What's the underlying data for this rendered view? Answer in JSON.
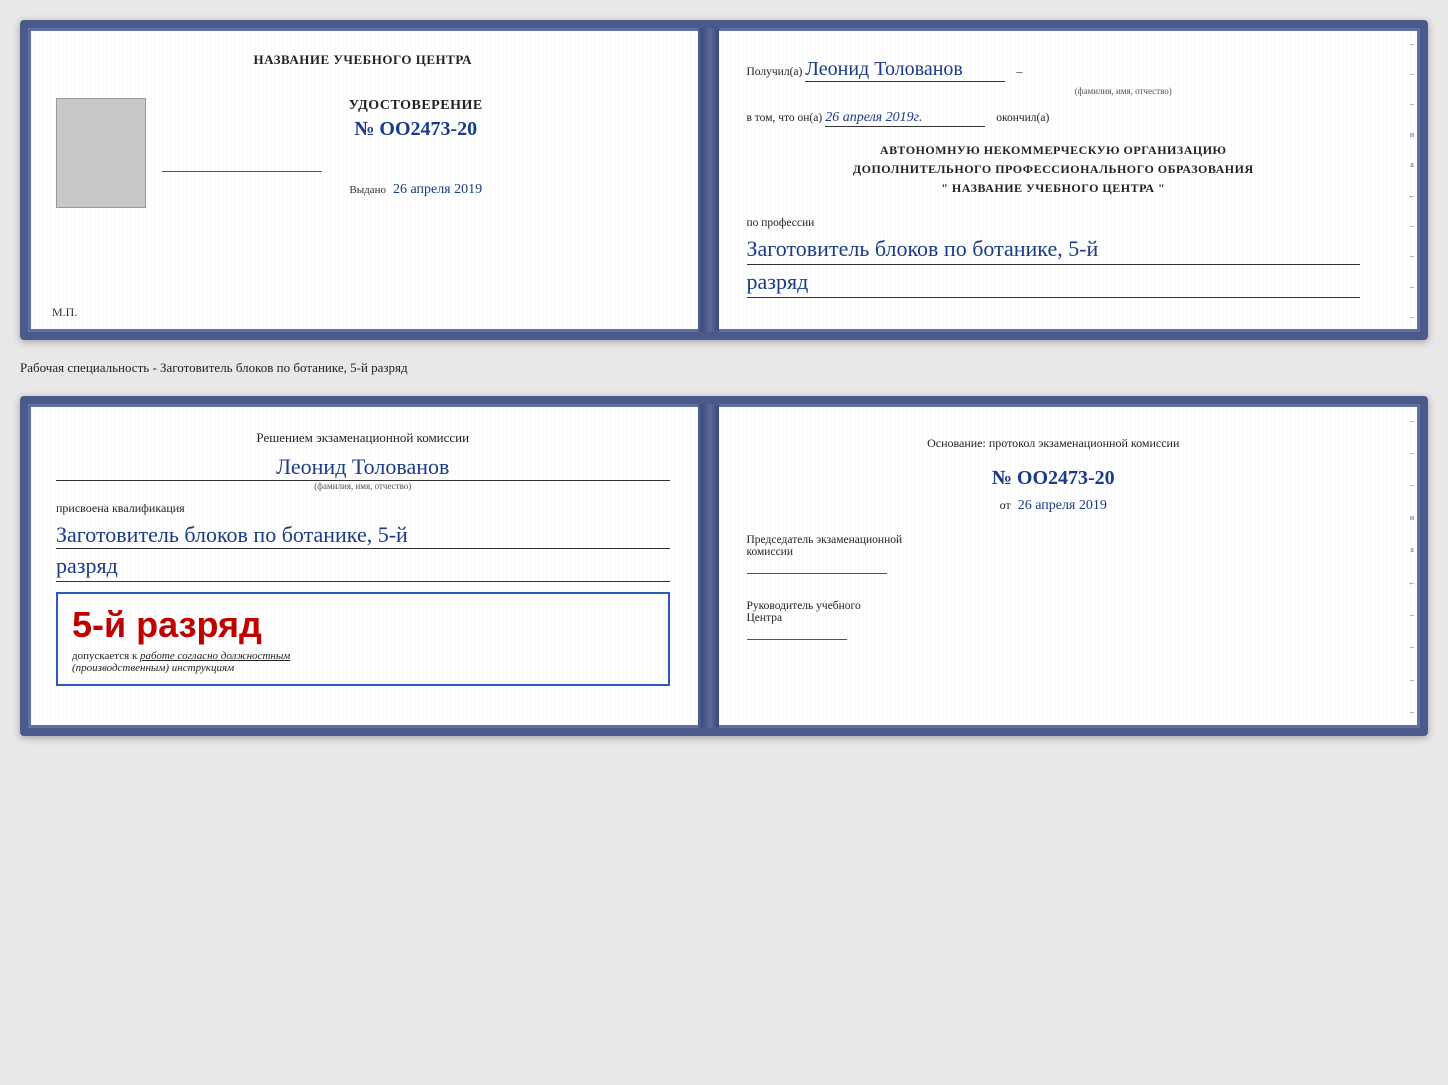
{
  "doc1": {
    "left": {
      "training_center_label": "НАЗВАНИЕ УЧЕБНОГО ЦЕНТРА",
      "certificate_label": "УДОСТОВЕРЕНИЕ",
      "cert_number": "№ OO2473-20",
      "issued_label": "Выдано",
      "issued_date": "26 апреля 2019",
      "mp_label": "М.П."
    },
    "right": {
      "received_prefix": "Получил(а)",
      "recipient_name": "Леонид Толованов",
      "fio_label": "(фамилия, имя, отчество)",
      "certified_prefix": "в том, что он(а)",
      "certified_date": "26 апреля 2019г.",
      "completed_label": "окончил(а)",
      "org_line1": "АВТОНОМНУЮ НЕКОММЕРЧЕСКУЮ ОРГАНИЗАЦИЮ",
      "org_line2": "ДОПОЛНИТЕЛЬНОГО ПРОФЕССИОНАЛЬНОГО ОБРАЗОВАНИЯ",
      "org_line3": "\"   НАЗВАНИЕ УЧЕБНОГО ЦЕНТРА   \"",
      "profession_label": "по профессии",
      "profession_name": "Заготовитель блоков по ботанике, 5-й",
      "profession_grade": "разряд"
    }
  },
  "between": {
    "specialty_text": "Рабочая специальность - Заготовитель блоков по ботанике, 5-й разряд"
  },
  "doc2": {
    "left": {
      "commission_prefix": "Решением экзаменационной комиссии",
      "recipient_name": "Леонид Толованов",
      "fio_label": "(фамилия, имя, отчество)",
      "qualification_label": "присвоена квалификация",
      "qualification_name": "Заготовитель блоков по ботанике, 5-й",
      "qualification_grade": "разряд",
      "grade_badge": "5-й разряд",
      "allowed_prefix": "допускается к",
      "allowed_text": "работе согласно должностным",
      "allowed_text2": "(производственным) инструкциям"
    },
    "right": {
      "basis_label": "Основание: протокол экзаменационной комиссии",
      "protocol_number": "№  OO2473-20",
      "from_label": "от",
      "from_date": "26 апреля 2019",
      "chairman_label": "Председатель экзаменационной",
      "chairman_label2": "комиссии",
      "director_label": "Руководитель учебного",
      "director_label2": "Центра"
    }
  },
  "edge_marks": [
    "–",
    "–",
    "–",
    "и",
    "а",
    "←",
    "–",
    "–",
    "–",
    "–"
  ]
}
